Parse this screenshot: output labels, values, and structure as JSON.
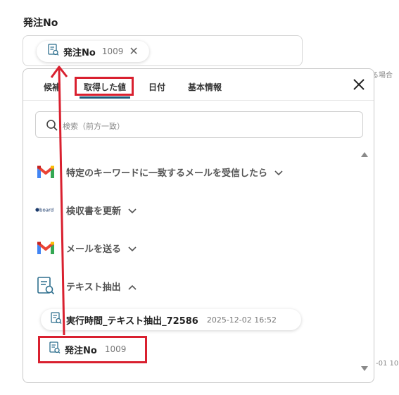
{
  "field": {
    "label": "発注No",
    "chip": {
      "label": "発注No",
      "number": "1009"
    }
  },
  "side_hints": {
    "right_top": "る場合",
    "right_bottom": "-01 10"
  },
  "panel": {
    "tabs": [
      {
        "label": "候補"
      },
      {
        "label": "取得した値",
        "active": true
      },
      {
        "label": "日付"
      },
      {
        "label": "基本情報"
      }
    ],
    "search_placeholder": "検索（前方一致）",
    "groups": [
      {
        "label": "特定のキーワードに一致するメールを受信したら",
        "icon": "gmail-icon",
        "expanded": false
      },
      {
        "label": "検収書を更新",
        "icon": "board-icon",
        "expanded": false
      },
      {
        "label": "メールを送る",
        "icon": "gmail-icon",
        "expanded": false
      },
      {
        "label": "テキスト抽出",
        "icon": "document-search-icon",
        "expanded": true
      }
    ],
    "items": [
      {
        "label": "実行時間_テキスト抽出_72586",
        "meta": "2025-12-02 16:52"
      },
      {
        "label": "発注No",
        "meta": "1009"
      }
    ]
  },
  "colors": {
    "accent": "#1d5b7a",
    "highlight": "#d9202f",
    "gmail_red": "#ea4335"
  }
}
